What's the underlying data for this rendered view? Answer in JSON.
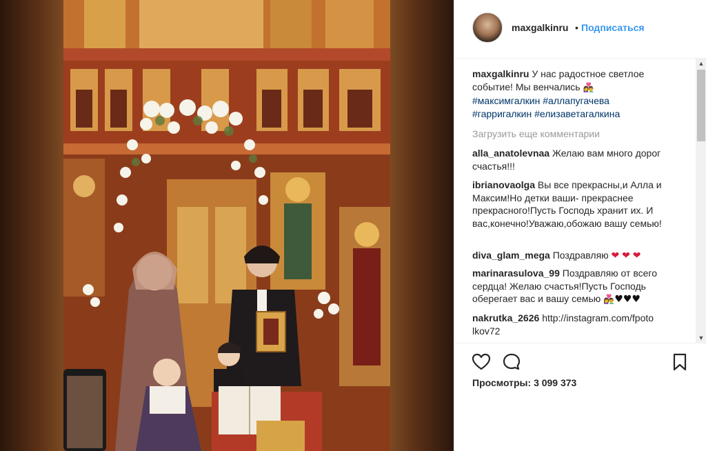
{
  "post": {
    "username": "maxgalkinru",
    "separator": "•",
    "follow_label": "Подписаться"
  },
  "caption": {
    "username": "maxgalkinru",
    "text": "У нас радостное светлое событие! Мы венчались",
    "tags": [
      "#максимгалкин",
      "#аллапугачева",
      "#гарригалкин",
      "#елизаветагалкина"
    ]
  },
  "load_more_label": "Загрузить еще комментарии",
  "comments": [
    {
      "user": "alla_anatolevnaa",
      "text": "Желаю вам много дорог счастья!!!"
    },
    {
      "user": "ibrianovaolga",
      "text": "Вы все прекрасны,и Алла и Максим!Но детки ваши- прекраснее прекрасного!Пусть Господь хранит их. И вас,конечно!Уважаю,обожаю вашу семью!"
    },
    {
      "user": "diva_glam_mega",
      "text": "Поздравляю"
    },
    {
      "user": "marinarasulova_99",
      "text": "Поздравляю от всего сердца! Желаю счастья!Пусть Господь оберегает вас и вашу семью"
    },
    {
      "user": "nakrutka_2626",
      "text": "http://instagram.com/fpoto lkov72"
    }
  ],
  "icons": {
    "like": "heart-outline-icon",
    "comment": "speech-bubble-icon",
    "save": "bookmark-icon"
  },
  "views": {
    "label": "Просмотры:",
    "count": "3 099 373"
  },
  "colors": {
    "link": "#3897f0",
    "hashtag": "#003569",
    "muted": "#999999",
    "text": "#262626"
  }
}
